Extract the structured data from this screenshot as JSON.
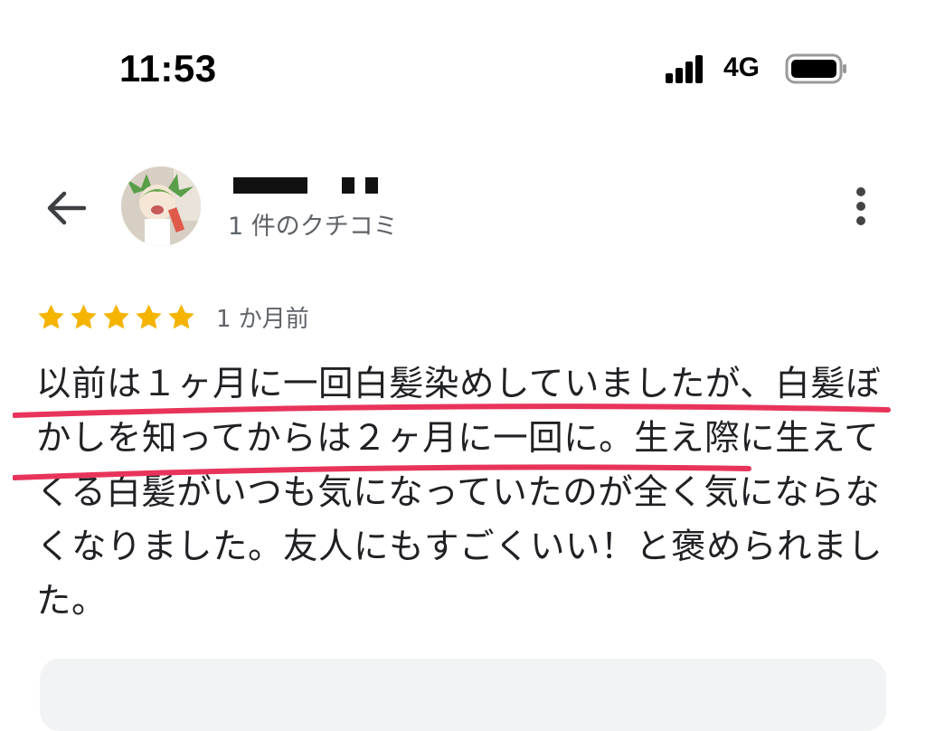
{
  "status_bar": {
    "time": "11:53",
    "network": "4G",
    "icons": [
      "signal-bars-icon",
      "battery-icon"
    ]
  },
  "header": {
    "review_count": "1 件のクチコミ",
    "icons": [
      "back-arrow-icon",
      "more-vert-icon"
    ]
  },
  "review": {
    "rating": 5,
    "rating_max": 5,
    "star_color": "#f4b400",
    "relative_time": "1 か月前",
    "text": "以前は１ヶ月に一回白髪染めしていましたが、白髪ぼかしを知ってからは２ヶ月に一回に。生え際に生えてくる白髪がいつも気になっていたのが全く気にならなくなりました。友人にもすごくいい！と褒められました。"
  },
  "colors": {
    "highlight_underline": "#e8345a",
    "secondary_text": "#5f6368"
  }
}
